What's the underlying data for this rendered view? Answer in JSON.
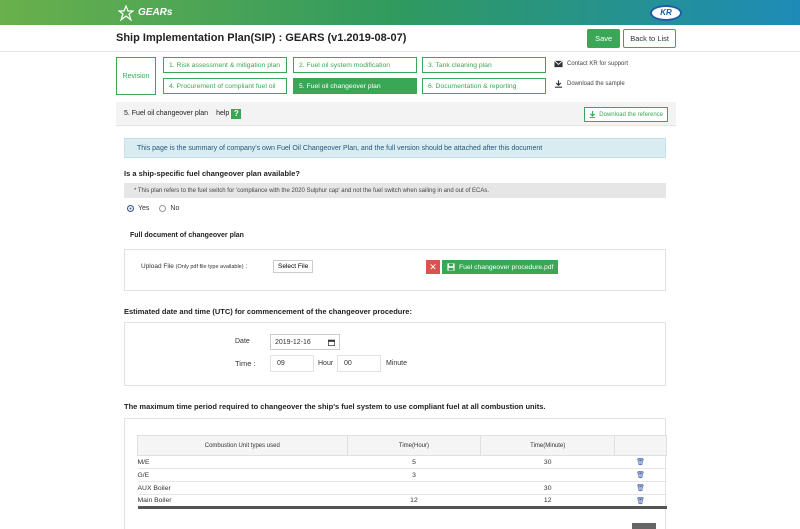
{
  "header": {
    "brand": "GEARs",
    "partner": "KR"
  },
  "title": "Ship Implementation Plan(SIP) : GEARS (v1.2019-08-07)",
  "actions": {
    "save": "Save",
    "back": "Back to List"
  },
  "steps": {
    "revision": "Revision",
    "items": [
      "1. Risk assessment & mitigation plan",
      "2. Fuel oil system modification",
      "3. Tank cleaning plan",
      "4. Procurement of compliant fuel oil",
      "5. Fuel oil changeover plan",
      "6. Documentation & reporting"
    ],
    "active_index": 4,
    "contact": "Contact KR for support",
    "download_sample": "Download the sample"
  },
  "section": {
    "title": "5. Fuel oil changeover plan",
    "help": "help",
    "help_icon": "?",
    "download_ref": "Download the reference"
  },
  "info": "This page is the summary of company's own Fuel Oil Changeover Plan, and the full version should be attached after this document",
  "question1": {
    "label": "Is a ship-specific fuel changeover plan available?",
    "note": "* This plan refers to the fuel switch for 'compliance with the 2020 Sulphur cap' and not the fuel switch when sailing in and out of ECAs.",
    "yes": "Yes",
    "no": "No",
    "selected": "Yes"
  },
  "full_doc": {
    "label": "Full document of changeover plan",
    "upload_label": "Upload File",
    "upload_hint": "(Only pdf file type available)",
    "upload_colon": ":",
    "select_button": "Select File",
    "remove_glyph": "✕",
    "file_name": "Fuel changeover procedure.pdf"
  },
  "estimate": {
    "label": "Estimated date and time (UTC) for commencement of the changeover procedure:",
    "date_label": "Date",
    "date_value": "2019-12-16",
    "time_label": "Time :",
    "hour_value": "09",
    "hour_label": "Hour",
    "minute_value": "00",
    "minute_label": "Minute"
  },
  "max_time": {
    "label": "The maximum time period required to changeover the ship's fuel system to use compliant fuel at all combustion units.",
    "columns": [
      "Combustion Unit types used",
      "Time(Hour)",
      "Time(Minute)",
      ""
    ],
    "rows": [
      {
        "unit": "M/E",
        "hour": "5",
        "minute": "30"
      },
      {
        "unit": "G/E",
        "hour": "3",
        "minute": ""
      },
      {
        "unit": "AUX Boiler",
        "hour": "",
        "minute": "30"
      },
      {
        "unit": "Main Boiler",
        "hour": "12",
        "minute": "12"
      }
    ]
  }
}
